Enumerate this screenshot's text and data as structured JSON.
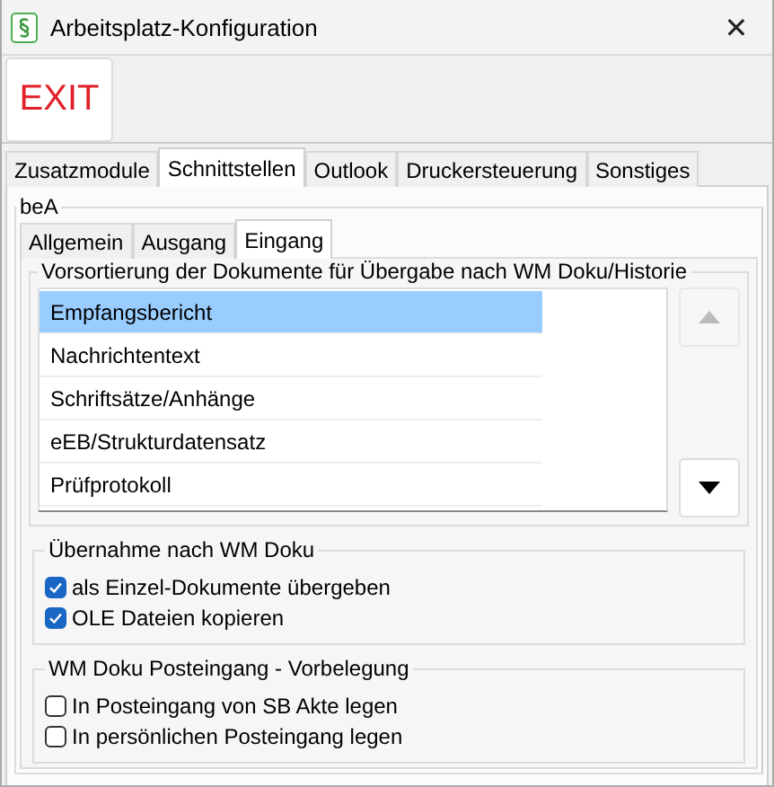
{
  "window": {
    "title": "Arbeitsplatz-Konfiguration",
    "close": "✕"
  },
  "toolbar": {
    "exit_button": "EXIT"
  },
  "tabs": [
    {
      "label": "Zusatzmodule",
      "selected": false
    },
    {
      "label": "Schnittstellen",
      "selected": true
    },
    {
      "label": "Outlook",
      "selected": false
    },
    {
      "label": "Druckersteuerung",
      "selected": false
    },
    {
      "label": "Sonstiges",
      "selected": false
    }
  ],
  "bea": {
    "title": "beA",
    "tabs": [
      {
        "label": "Allgemein",
        "selected": false
      },
      {
        "label": "Ausgang",
        "selected": false
      },
      {
        "label": "Eingang",
        "selected": true
      }
    ],
    "sort_group": {
      "title": "Vorsortierung der Dokumente für Übergabe nach WM Doku/Historie",
      "items": [
        {
          "label": "Empfangsbericht",
          "selected": true
        },
        {
          "label": "Nachrichtentext",
          "selected": false
        },
        {
          "label": "Schriftsätze/Anhänge",
          "selected": false
        },
        {
          "label": "eEB/Strukturdatensatz",
          "selected": false
        },
        {
          "label": "Prüfprotokoll",
          "selected": false
        }
      ],
      "move_up": {
        "disabled": true
      },
      "move_down": {
        "disabled": false
      }
    },
    "groups": [
      {
        "title": "Übernahme nach WM Doku",
        "options": [
          {
            "label": "als Einzel-Dokumente übergeben",
            "checked": true
          },
          {
            "label": "OLE Dateien kopieren",
            "checked": true
          }
        ]
      },
      {
        "title": "WM Doku Posteingang - Vorbelegung",
        "options": [
          {
            "label": "In Posteingang von SB Akte legen",
            "checked": false
          },
          {
            "label": "In persönlichen Posteingang legen",
            "checked": false
          }
        ]
      }
    ]
  }
}
